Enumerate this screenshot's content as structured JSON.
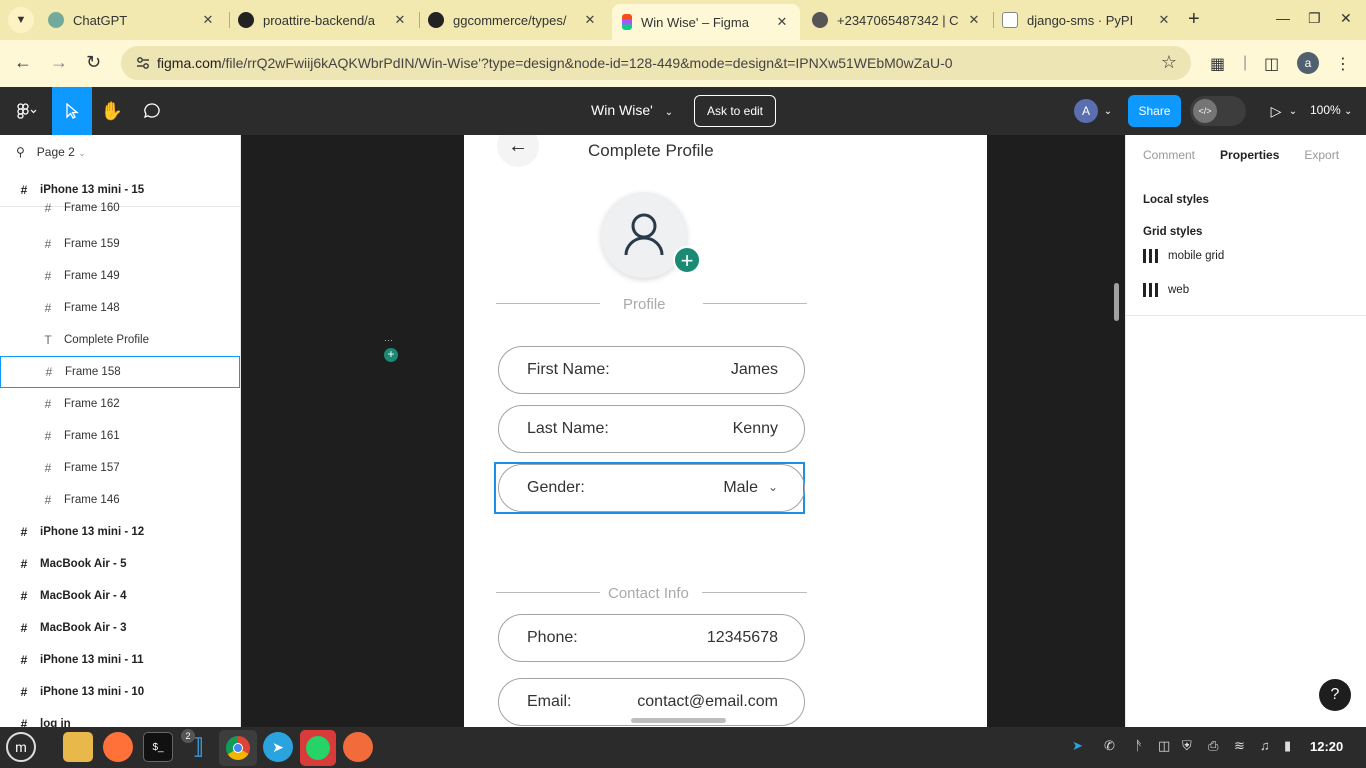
{
  "browser": {
    "tabs": [
      {
        "title": "ChatGPT",
        "favicon_color": "#74aa9c"
      },
      {
        "title": "proattire-backend/a",
        "favicon_color": "#222222"
      },
      {
        "title": "ggcommerce/types/",
        "favicon_color": "#222222"
      },
      {
        "title": "Win Wise' – Figma",
        "favicon_color": "#f24e1e",
        "active": true
      },
      {
        "title": "+2347065487342 | C",
        "favicon_color": "#555555"
      },
      {
        "title": "django-sms · PyPI",
        "favicon_color": "#3775a9"
      }
    ],
    "url_host": "figma.com",
    "url_path": "/file/rrQ2wFwiij6kAQKWbrPdIN/Win-Wise'?type=design&node-id=128-449&mode=design&t=IPNXw51WEbM0wZaU-0",
    "profile_initial": "a"
  },
  "figma": {
    "file_name": "Win Wise'",
    "ask_to_edit": "Ask to edit",
    "collaborator_initial": "A",
    "share_label": "Share",
    "zoom": "100%"
  },
  "layers": {
    "page": "Page 2",
    "items": [
      {
        "label": "iPhone 13 mini - 15",
        "level": "top",
        "icon": "frame-icon"
      },
      {
        "label": "Frame 160",
        "level": "child",
        "icon": "frame-icon"
      },
      {
        "label": "Frame 159",
        "level": "child",
        "icon": "frame-icon"
      },
      {
        "label": "Frame 149",
        "level": "child",
        "icon": "frame-icon"
      },
      {
        "label": "Frame 148",
        "level": "child",
        "icon": "frame-icon"
      },
      {
        "label": "Complete Profile",
        "level": "child",
        "icon": "text-icon"
      },
      {
        "label": "Frame 158",
        "level": "child",
        "icon": "frame-icon",
        "selected": true
      },
      {
        "label": "Frame 162",
        "level": "child",
        "icon": "frame-icon"
      },
      {
        "label": "Frame 161",
        "level": "child",
        "icon": "frame-icon"
      },
      {
        "label": "Frame 157",
        "level": "child",
        "icon": "frame-icon"
      },
      {
        "label": "Frame 146",
        "level": "child",
        "icon": "frame-icon"
      },
      {
        "label": "iPhone 13 mini - 12",
        "level": "top",
        "icon": "frame-icon"
      },
      {
        "label": "MacBook Air - 5",
        "level": "top",
        "icon": "frame-icon"
      },
      {
        "label": "MacBook Air - 4",
        "level": "top",
        "icon": "frame-icon"
      },
      {
        "label": "MacBook Air - 3",
        "level": "top",
        "icon": "frame-icon"
      },
      {
        "label": "iPhone 13 mini - 11",
        "level": "top",
        "icon": "frame-icon"
      },
      {
        "label": "iPhone 13 mini - 10",
        "level": "top",
        "icon": "frame-icon"
      },
      {
        "label": "log in",
        "level": "top",
        "icon": "frame-icon"
      }
    ]
  },
  "design": {
    "title": "Complete Profile",
    "profile_section": "Profile",
    "contact_section": "Contact Info",
    "fields": {
      "first_name": {
        "label": "First Name:",
        "value": "James"
      },
      "last_name": {
        "label": "Last Name:",
        "value": "Kenny"
      },
      "gender": {
        "label": "Gender:",
        "value": "Male"
      },
      "phone": {
        "label": "Phone:",
        "value": "12345678"
      },
      "email": {
        "label": "Email:",
        "value": "contact@email.com"
      }
    },
    "accent_color": "#1a8a74"
  },
  "right_panel": {
    "tabs": [
      "Comment",
      "Properties",
      "Export"
    ],
    "active_tab": "Properties",
    "local_styles": "Local styles",
    "grid_styles": "Grid styles",
    "grids": [
      "mobile grid",
      "web"
    ],
    "help": "?"
  },
  "taskbar": {
    "vscode_badge": "2",
    "clock": "12:20"
  }
}
